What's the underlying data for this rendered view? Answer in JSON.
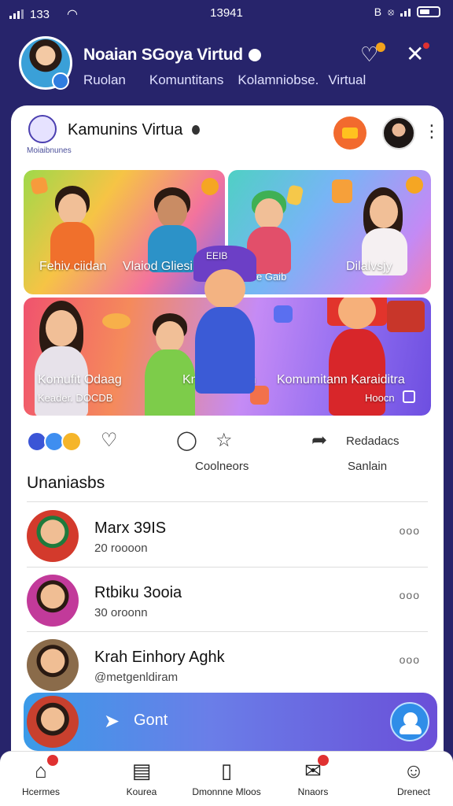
{
  "status_bar": {
    "time_left": "133",
    "time_center": "13941"
  },
  "header": {
    "title": "Noaian SGoya Virtud",
    "tabs": [
      "Ruolan",
      "Komuntitans",
      "Kolamniobse.",
      "Virtual"
    ]
  },
  "community": {
    "title": "Kamunins Virtua",
    "subtitle": "Moiaibnunes"
  },
  "collage": {
    "labels": [
      "Fehiv ciidan",
      "Vlaiod Gliesib",
      "Dilalvsjy",
      "EEIB",
      "e Gaib",
      "Komufit Odaag",
      "Kneotoniigan",
      "Komumitann Karaiditra"
    ],
    "footer_left": "Keader. DOCDB",
    "footer_right": "Hoocn"
  },
  "actions": {
    "comments_label": "Coolneors",
    "share_label": "Redadacs",
    "save_label": "Sanlain"
  },
  "section_title": "Unaniasbs",
  "members": [
    {
      "name": "Marx 39IS",
      "sub": "20 roooon",
      "more": "ooo"
    },
    {
      "name": "Rtbiku 3ooia",
      "sub": "30 oroonn",
      "more": "ooo"
    },
    {
      "name": "Krah Einhory Aghk",
      "sub": "@metgenldiram",
      "more": "ooo"
    }
  ],
  "chat_bar": {
    "label": "Gont"
  },
  "bottom_nav": [
    {
      "label": "Hcermes",
      "icon": "home-icon"
    },
    {
      "label": "Kourea",
      "icon": "inbox-icon"
    },
    {
      "label": "Dmonnne Mloos",
      "icon": "document-icon"
    },
    {
      "label": "Nnaors",
      "icon": "mail-icon"
    },
    {
      "label": "Drenect",
      "icon": "profile-icon"
    }
  ],
  "colors": {
    "background": "#27246b",
    "accent_orange": "#f26a2e",
    "badge_red": "#e03131",
    "chat_gradient_start": "#3a9be8",
    "chat_gradient_end": "#6a4fd8"
  }
}
